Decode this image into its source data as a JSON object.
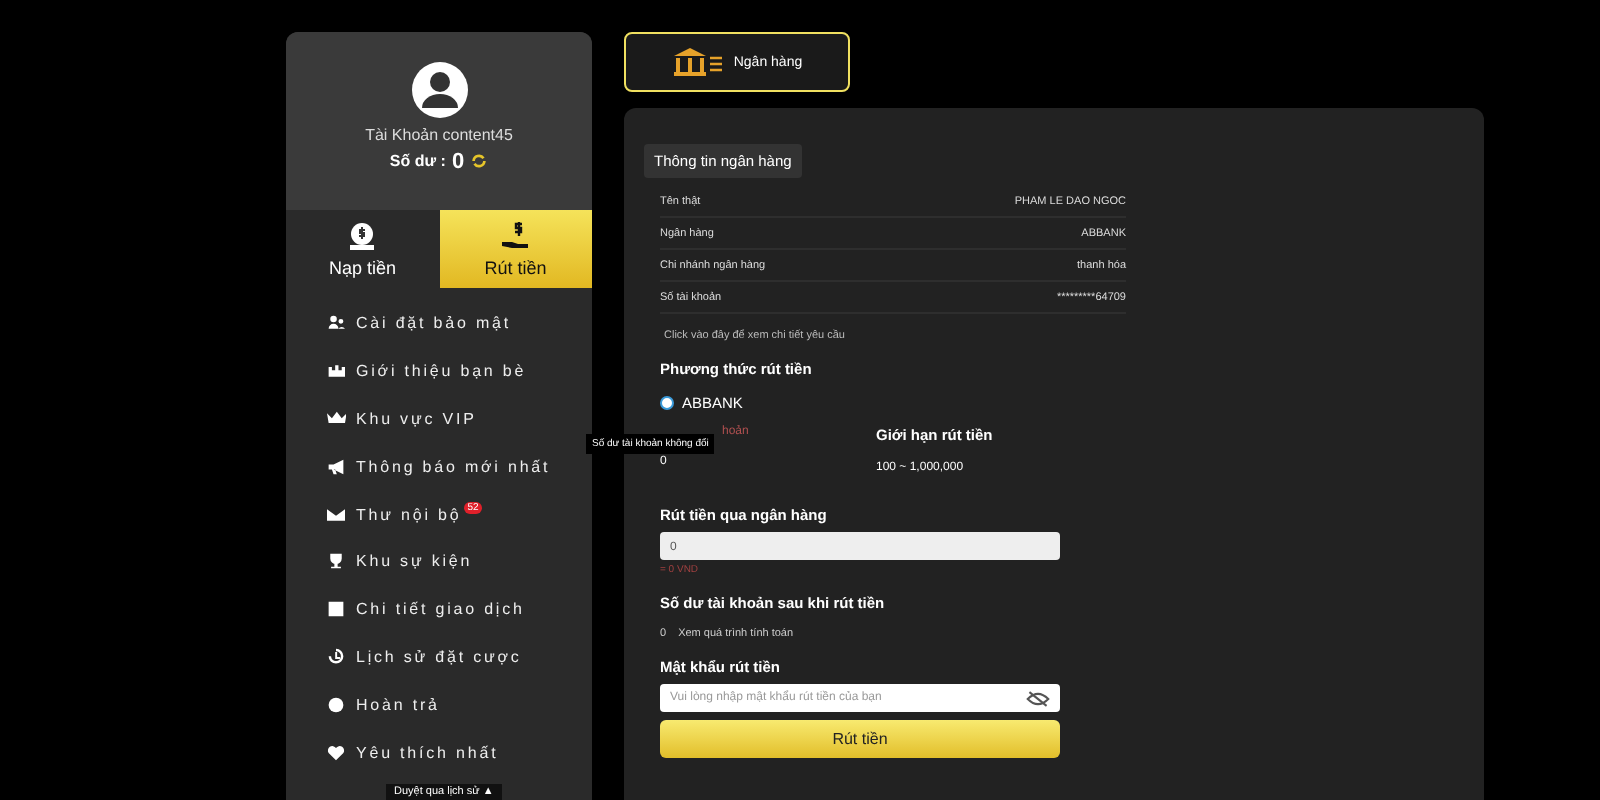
{
  "account": {
    "username": "Tài Khoản content45",
    "balance_label": "Số dư :",
    "balance": "0"
  },
  "action_tabs": [
    {
      "label": "Nạp tiền",
      "kind": "deposit",
      "selected": false
    },
    {
      "label": "Rút tiền",
      "kind": "withdraw",
      "selected": true
    }
  ],
  "menu": [
    {
      "label": "Cài đặt bảo mật",
      "kind": "security"
    },
    {
      "label": "Giới thiệu bạn bè",
      "kind": "friends"
    },
    {
      "label": "Khu vực VIP",
      "kind": "vip"
    },
    {
      "label": "Thông báo mới nhất",
      "kind": "announce"
    },
    {
      "label": "Thư nội bộ",
      "kind": "mail",
      "badge": "52"
    },
    {
      "label": "Khu sự kiện",
      "kind": "event"
    },
    {
      "label": "Chi tiết giao dịch",
      "kind": "transactions"
    },
    {
      "label": "Lịch sử đặt cược",
      "kind": "history"
    },
    {
      "label": "Hoàn trả",
      "kind": "refund"
    },
    {
      "label": "Yêu thích nhất",
      "kind": "favorite"
    }
  ],
  "history_link": "Duyệt qua lịch sử ▲",
  "method_tabs": [
    {
      "label": "Ngân hàng",
      "selected": true
    }
  ],
  "bank_info": {
    "heading": "Thông tin ngân hàng",
    "rows": [
      {
        "label": "Tên thật",
        "value": "PHAM LE DAO NGOC"
      },
      {
        "label": "Ngân hàng",
        "value": "ABBANK"
      },
      {
        "label": "Chi nhánh ngân hàng",
        "value": "thanh hóa"
      },
      {
        "label": "Số tài khoản",
        "value": "*********64709"
      }
    ],
    "details_link": "Click vào đây để xem chi tiết yêu cầu"
  },
  "withdraw_method": {
    "heading": "Phương thức rút tiền",
    "options": [
      {
        "label": "ABBANK",
        "selected": true
      }
    ]
  },
  "summary": [
    {
      "label": "hoản",
      "value": "0",
      "kind": "warning"
    },
    {
      "label": "Giới hạn rút tiền",
      "value": "100 ~ 1,000,000",
      "kind": "normal"
    }
  ],
  "tooltip": "Số dư tài khoản không đổi",
  "amount": {
    "label": "Rút tiền qua ngân hàng",
    "value": "0",
    "note": "= 0 VND"
  },
  "after_balance": {
    "label": "Số dư tài khoản sau khi rút tiền",
    "value": "0",
    "link": "Xem quá trình tính toán"
  },
  "password": {
    "label": "Mật khẩu rút tiền",
    "placeholder": "Vui lòng nhập mật khẩu rút tiền của bạn"
  },
  "submit": "Rút tiền"
}
